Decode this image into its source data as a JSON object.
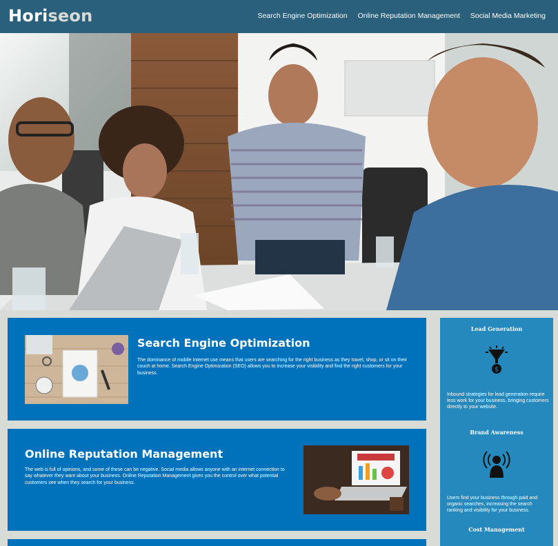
{
  "header": {
    "logo_main": "Hori",
    "logo_accent": "seon",
    "nav": [
      "Search Engine Optimization",
      "Online Reputation Management",
      "Social Media Marketing"
    ]
  },
  "content": [
    {
      "title": "Search Engine Optimization",
      "text": "The dominance of mobile internet use means that users are searching for the right business as they travel, shop, or sit on their couch at home. Search Engine Optimization (SEO) allows you to increase your visibility and find the right customers for your business.",
      "image_icon": "seo-planning-desk-image"
    },
    {
      "title": "Online Reputation Management",
      "text": "The web is full of opinions, and some of these can be negative. Social media allows anyone with an internet connection to say whatever they want about your business. Online Reputation Management gives you the control over what potential customers see when they search for your business.",
      "image_icon": "reputation-laptop-image"
    }
  ],
  "benefits": [
    {
      "title": "Lead Generation",
      "text": "Inbound strategies for lead generation require less work for your business, bringing customers directly to your website.",
      "icon": "funnel-dollar-icon"
    },
    {
      "title": "Brand Awareness",
      "text": "Users find your business through paid and organic searches, increasing the search ranking and visibility for your business.",
      "icon": "person-broadcast-icon"
    },
    {
      "title": "Cost Management",
      "text": "",
      "icon": ""
    }
  ],
  "colors": {
    "header_bg": "#2a607c",
    "content_bg": "#0072bb",
    "sidebar_bg": "#2589bd",
    "page_bg": "#d9dcd6",
    "logo_accent": "#d9dcd6"
  }
}
